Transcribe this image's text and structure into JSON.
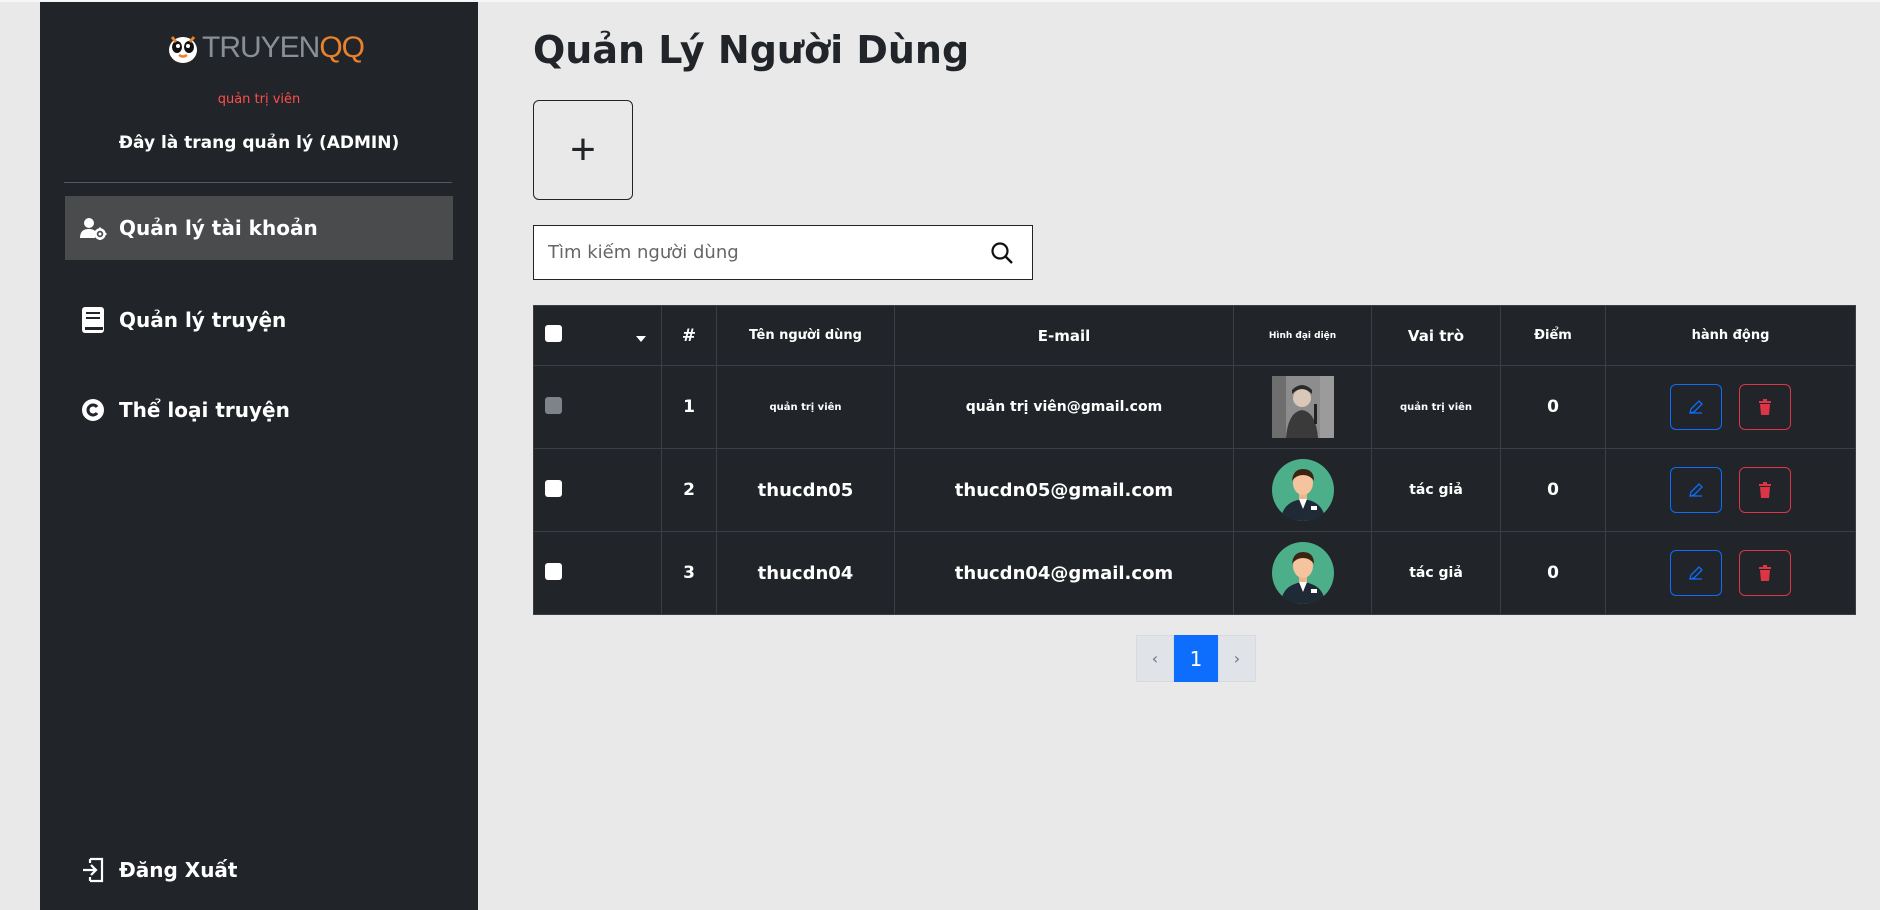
{
  "app": {
    "logo_part1": "TRUYEN",
    "logo_part2": "QQ",
    "role": "quản trị viên",
    "welcome": "Đây là trang quản lý (ADMIN)"
  },
  "sidebar": {
    "items": [
      {
        "label": "Quản lý tài khoản",
        "icon": "user-gear-icon",
        "active": true
      },
      {
        "label": "Quản lý truyện",
        "icon": "book-icon",
        "active": false
      },
      {
        "label": "Thể loại truyện",
        "icon": "copyright-icon",
        "active": false
      }
    ],
    "logout": {
      "label": "Đăng Xuất",
      "icon": "logout-icon"
    }
  },
  "main": {
    "title": "Quản Lý Người Dùng",
    "add_label": "+",
    "search_placeholder": "Tìm kiếm người dùng"
  },
  "table": {
    "headers": {
      "index": "#",
      "username": "Tên người dùng",
      "email": "E-mail",
      "avatar": "Hình đại diện",
      "role": "Vai trò",
      "points": "Điểm",
      "actions": "hành động"
    },
    "rows": [
      {
        "index": "1",
        "username": "quản trị viên",
        "email": "quản trị viên@gmail.com",
        "avatar": "photo",
        "role": "quản trị viên",
        "points": "0"
      },
      {
        "index": "2",
        "username": "thucdn05",
        "email": "thucdn05@gmail.com",
        "avatar": "default-avatar",
        "role": "tác giả",
        "points": "0"
      },
      {
        "index": "3",
        "username": "thucdn04",
        "email": "thucdn04@gmail.com",
        "avatar": "default-avatar",
        "role": "tác giả",
        "points": "0"
      }
    ]
  },
  "pagination": {
    "prev": "‹",
    "current": "1",
    "next": "›"
  },
  "colors": {
    "sidebar_bg": "#212529",
    "active_item_bg": "#4a4b4d",
    "accent_blue": "#0d6efd",
    "danger_red": "#dc3545",
    "logo_orange": "#e9822a",
    "role_red": "#ff4d4d"
  }
}
